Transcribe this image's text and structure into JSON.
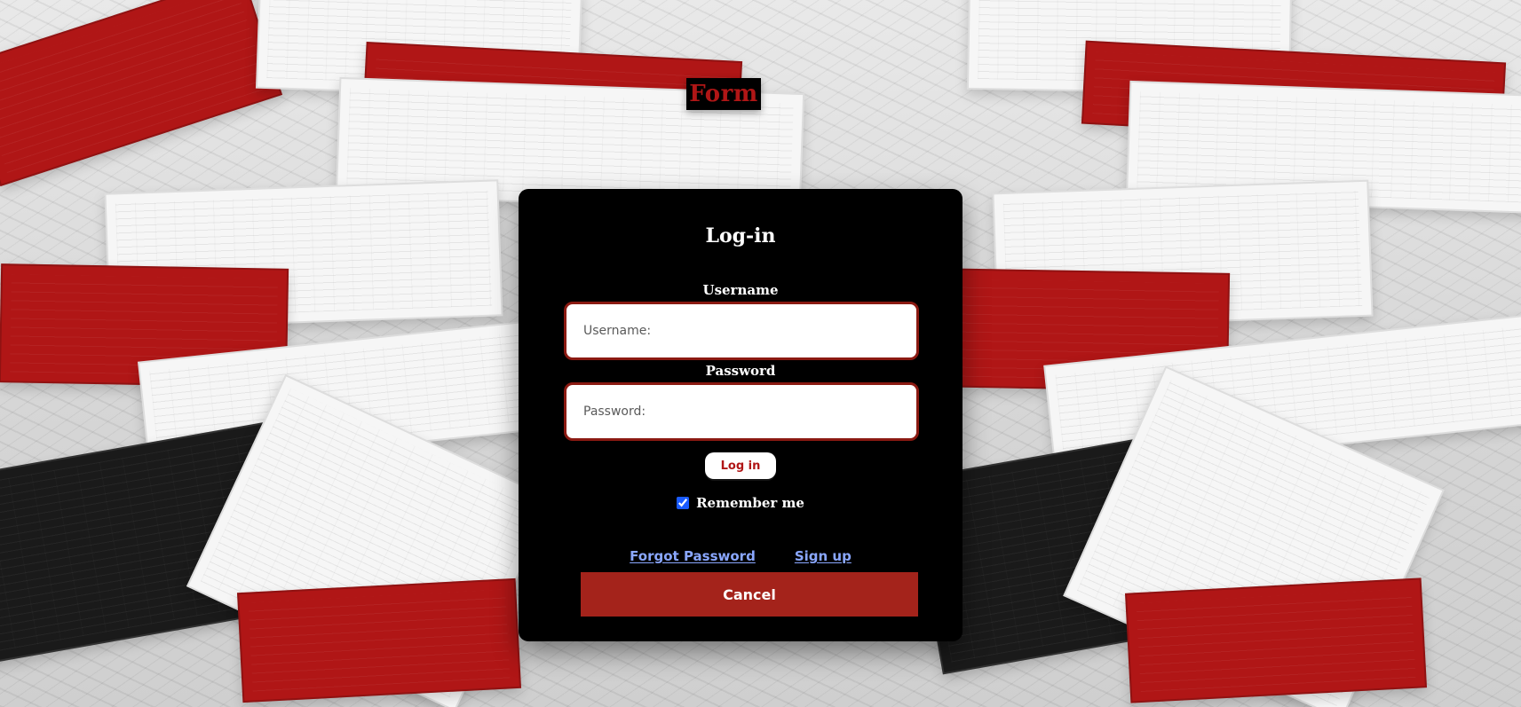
{
  "header": {
    "form_tag_text": "Form"
  },
  "login": {
    "title": "Log-in",
    "username": {
      "label": "Username",
      "placeholder": "Username:",
      "value": ""
    },
    "password": {
      "label": "Password",
      "placeholder": "Password:",
      "value": ""
    },
    "login_button_label": "Log in",
    "remember_me": {
      "label": "Remember me",
      "checked": true
    },
    "links": {
      "forgot_password": "Forgot Password",
      "sign_up": "Sign up"
    },
    "cancel_button_label": "Cancel"
  },
  "theme": {
    "card_bg": "#000000",
    "accent_red": "#b01616",
    "cancel_red": "#a4231b",
    "link_blue": "#8aa7ff",
    "field_border": "#8b1a12",
    "checkbox_blue": "#1a5bff"
  },
  "icons": {
    "checkbox": "checkbox-checked-icon"
  }
}
